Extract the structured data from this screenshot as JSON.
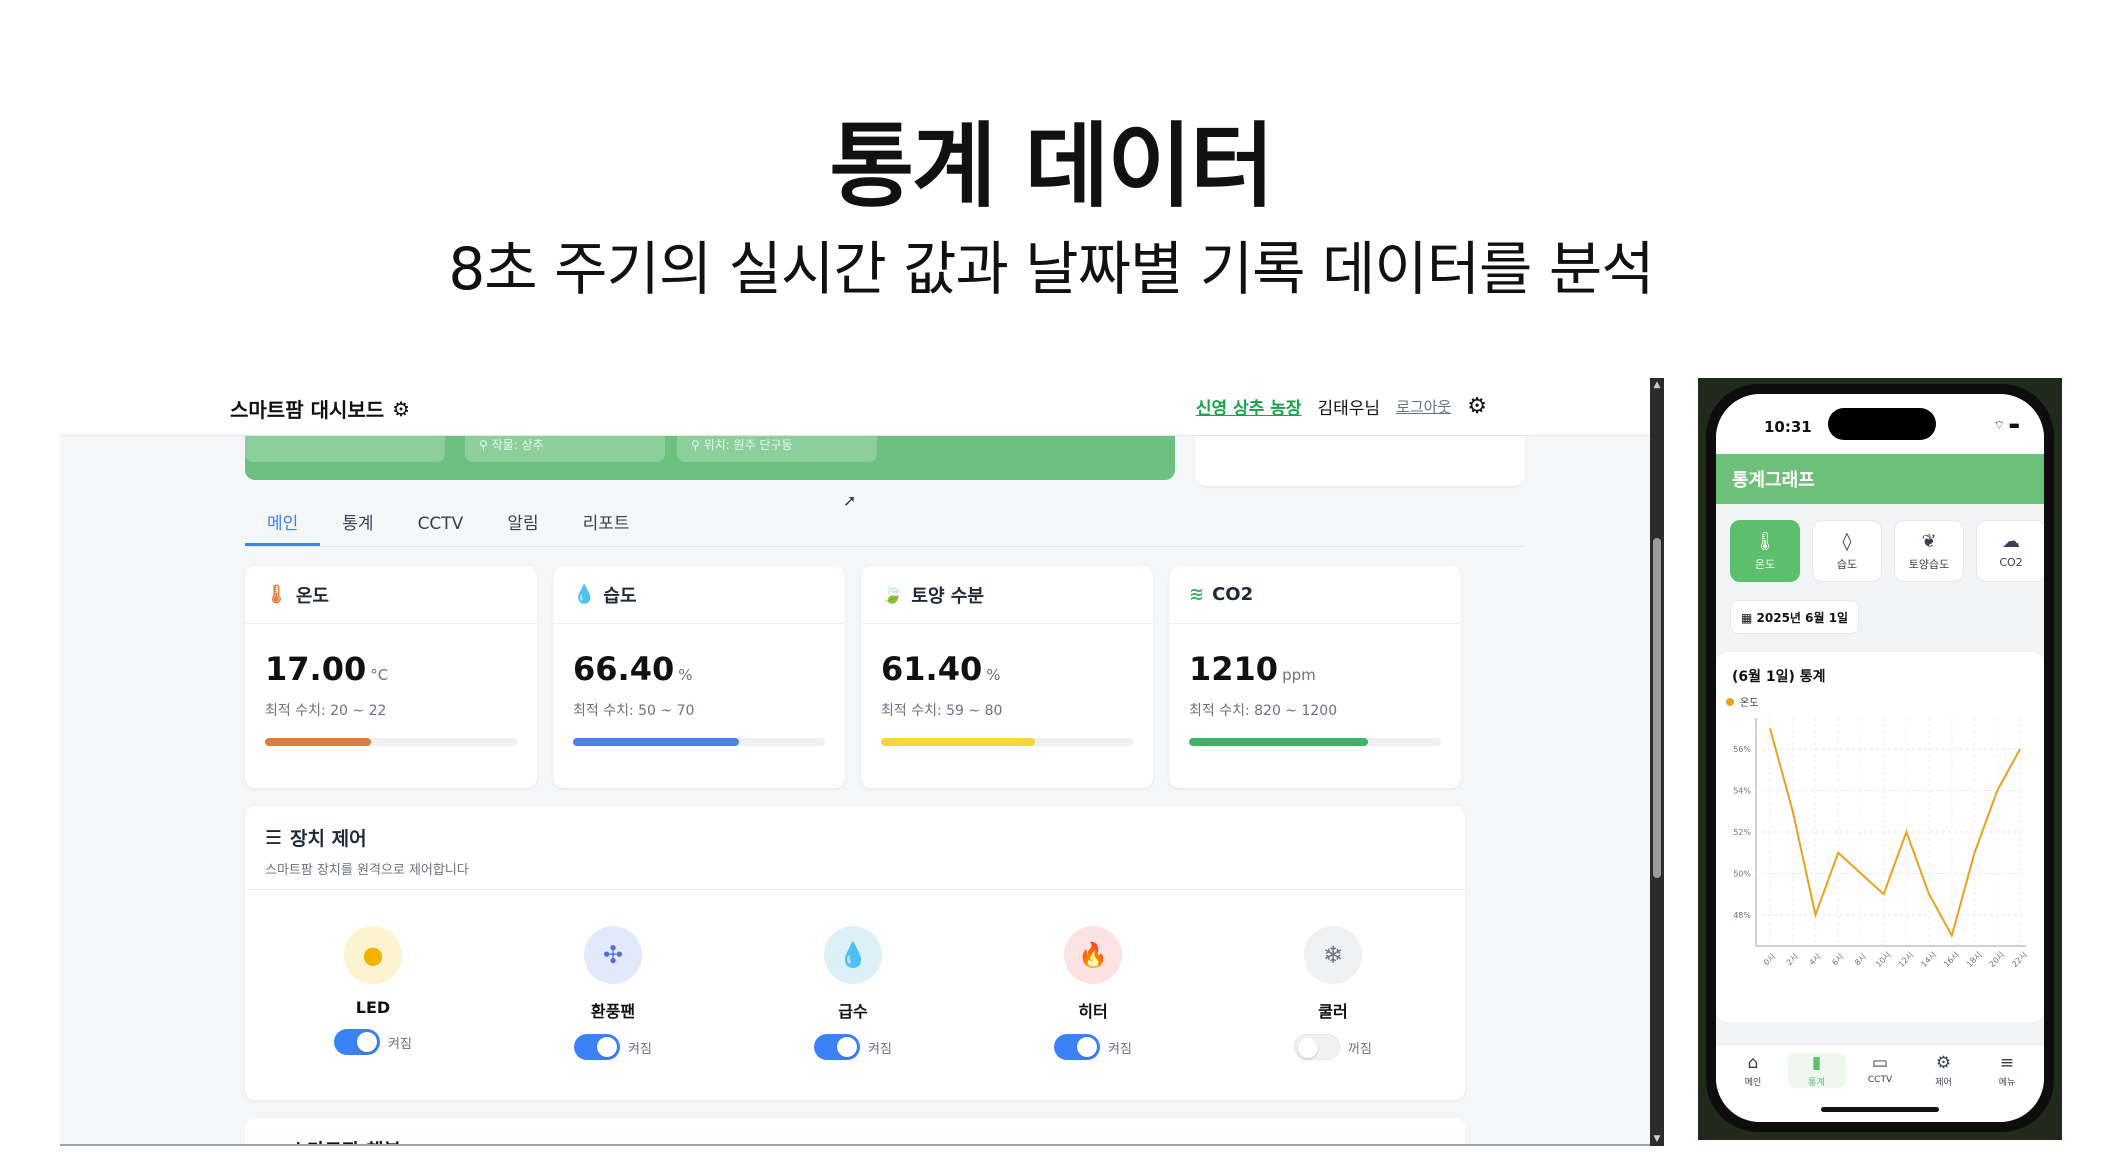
{
  "slide": {
    "title": "통계 데이터",
    "subtitle": "8초 주기의 실시간 값과 날짜별 기록 데이터를 분석"
  },
  "desktop": {
    "header": {
      "brand": "스마트팜 대시보드",
      "farm_link": "신영 상추 농장",
      "user": "김태우님",
      "logout": "로그아웃"
    },
    "banner_chips": [
      "작물: 상추",
      "위치: 원주 단구동"
    ],
    "tabs": [
      {
        "label": "메인",
        "active": true
      },
      {
        "label": "통계",
        "active": false
      },
      {
        "label": "CCTV",
        "active": false
      },
      {
        "label": "알림",
        "active": false
      },
      {
        "label": "리포트",
        "active": false
      }
    ],
    "metrics": [
      {
        "icon": "thermometer-icon",
        "label": "온도",
        "value": "17.00",
        "unit": "°C",
        "range": "최적 수치: 20 ~ 22",
        "level": 0.42,
        "color": "#e07b39"
      },
      {
        "icon": "droplet-icon",
        "label": "습도",
        "value": "66.40",
        "unit": "%",
        "range": "최적 수치: 50 ~ 70",
        "level": 0.66,
        "color": "#4f7fe8"
      },
      {
        "icon": "leaf-icon",
        "label": "토양 수분",
        "value": "61.40",
        "unit": "%",
        "range": "최적 수치: 59 ~ 80",
        "level": 0.61,
        "color": "#f4d63a"
      },
      {
        "icon": "wind-icon",
        "label": "CO2",
        "value": "1210",
        "unit": "ppm",
        "range": "최적 수치: 820 ~ 1200",
        "level": 0.71,
        "color": "#3fb36b"
      }
    ],
    "control": {
      "title": "장치 제어",
      "description": "스마트팜 장치를 원격으로 제어합니다",
      "devices": [
        {
          "name": "LED",
          "state": "켜짐",
          "on": true,
          "icon": "bulb-icon",
          "bg": "#fdf3d0",
          "fg": "#f0b400"
        },
        {
          "name": "환풍팬",
          "state": "켜짐",
          "on": true,
          "icon": "fan-icon",
          "bg": "#e2e9fb",
          "fg": "#4f6fe0"
        },
        {
          "name": "급수",
          "state": "켜짐",
          "on": true,
          "icon": "water-drop-icon",
          "bg": "#ddf0f6",
          "fg": "#2f9ec2"
        },
        {
          "name": "히터",
          "state": "켜짐",
          "on": true,
          "icon": "flame-icon",
          "bg": "#fde2e2",
          "fg": "#e24c4c"
        },
        {
          "name": "쿨러",
          "state": "꺼짐",
          "on": false,
          "icon": "snowflake-icon",
          "bg": "#eef0f2",
          "fg": "#6b7280"
        }
      ]
    },
    "bottom_card": "스마트팜 챗봇"
  },
  "phone": {
    "time": "10:31",
    "app_title": "통계그래프",
    "categories": [
      {
        "label": "온도",
        "icon": "thermometer-icon",
        "active": true
      },
      {
        "label": "습도",
        "icon": "droplet-icon",
        "active": false
      },
      {
        "label": "토양습도",
        "icon": "leaf-icon",
        "active": false
      },
      {
        "label": "CO2",
        "icon": "cloud-icon",
        "active": false
      }
    ],
    "date": "2025년 6월 1일",
    "chart_title": "(6월 1일) 통계",
    "nav": [
      {
        "label": "메인",
        "icon": "home-icon",
        "active": false
      },
      {
        "label": "통계",
        "icon": "bar-chart-icon",
        "active": true
      },
      {
        "label": "CCTV",
        "icon": "camera-icon",
        "active": false
      },
      {
        "label": "제어",
        "icon": "settings-icon",
        "active": false
      },
      {
        "label": "메뉴",
        "icon": "menu-icon",
        "active": false
      }
    ]
  },
  "chart_data": {
    "type": "line",
    "title": "(6월 1일) 통계",
    "series": [
      {
        "name": "온도",
        "color": "#e8a21f",
        "values": [
          57,
          53,
          48,
          51,
          50,
          49,
          52,
          49,
          47,
          51,
          54,
          56
        ]
      }
    ],
    "x": [
      "0시",
      "2시",
      "4시",
      "6시",
      "8시",
      "10시",
      "12시",
      "14시",
      "16시",
      "18시",
      "20시",
      "22시"
    ],
    "y_ticks": [
      "56%",
      "54%",
      "52%",
      "50%",
      "48%"
    ],
    "ylim": [
      46.5,
      57.5
    ],
    "grid": true,
    "legend": "top-left"
  }
}
